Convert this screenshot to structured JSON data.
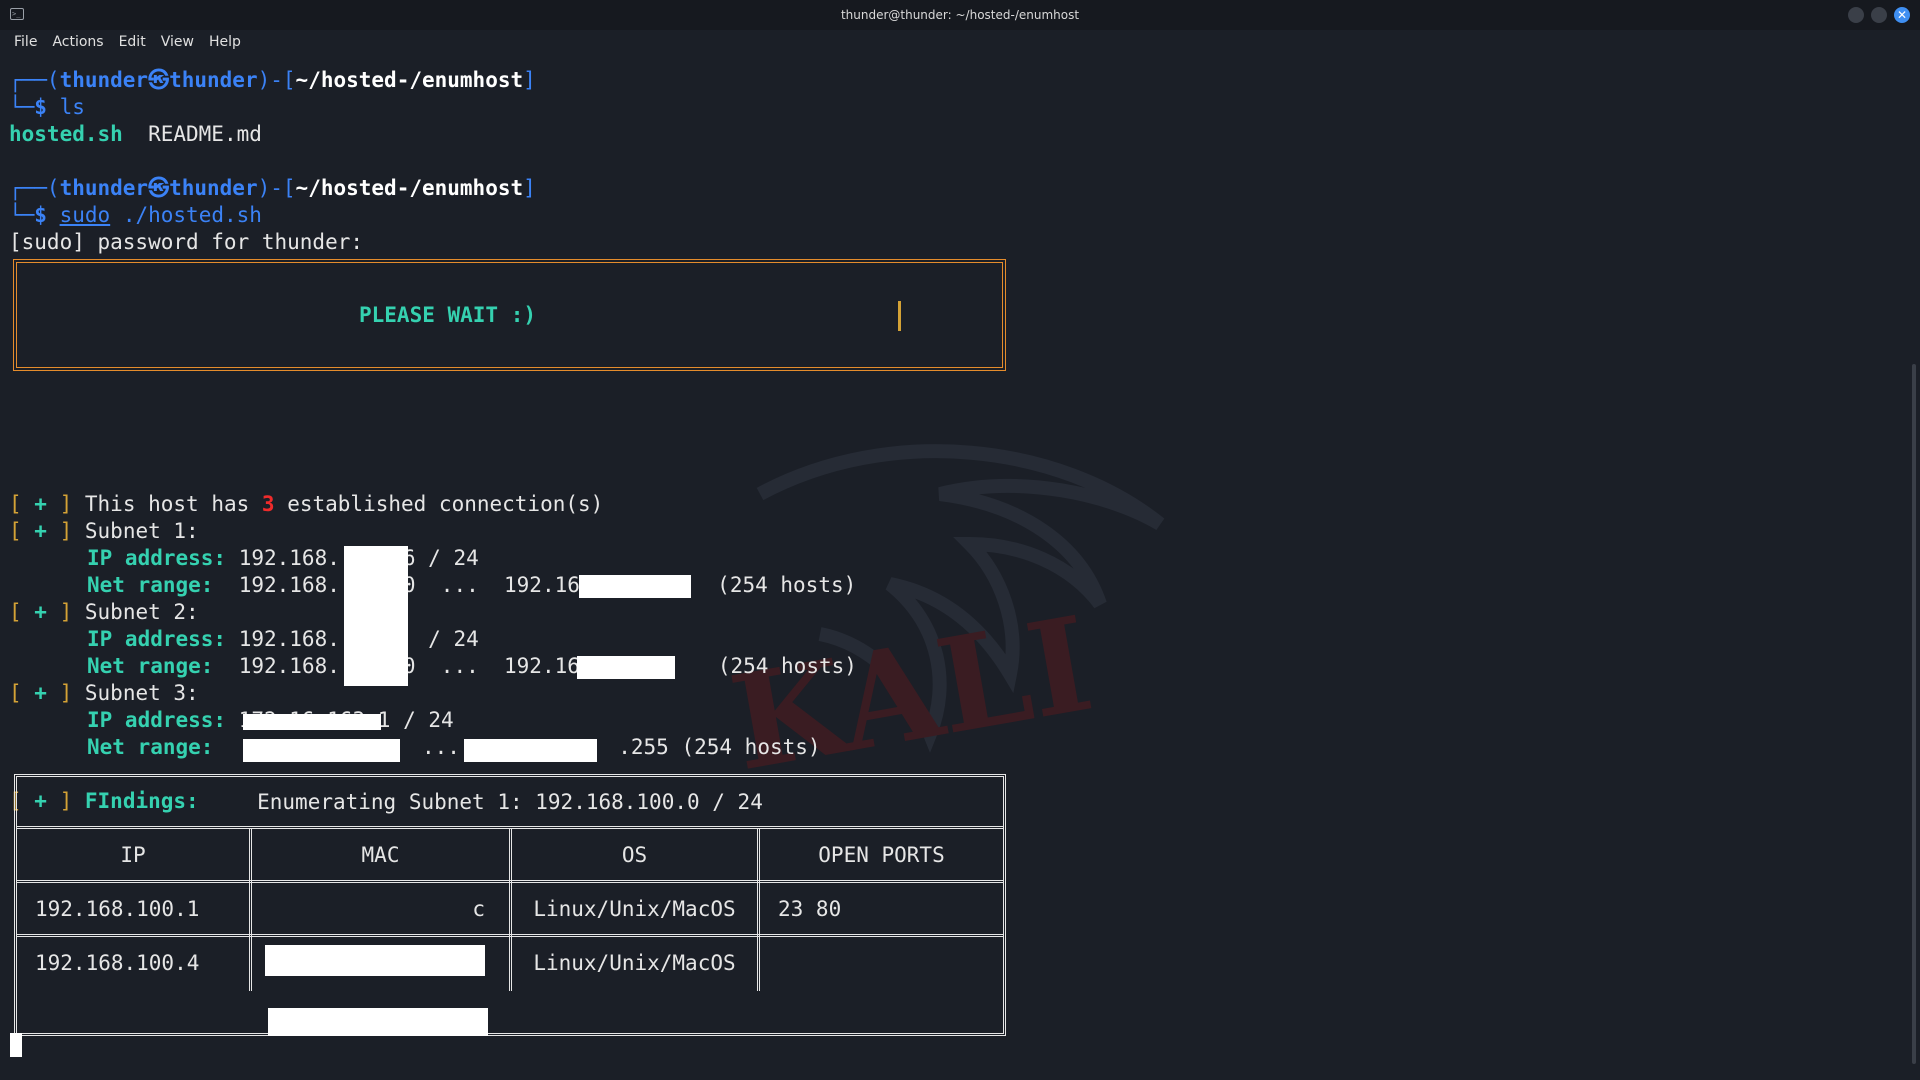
{
  "window": {
    "title": "thunder@thunder: ~/hosted-/enumhost",
    "icons": {
      "app": "terminal-icon",
      "minimize": "minimize-icon",
      "maximize": "maximize-icon",
      "close": "close-icon"
    },
    "close_glyph": "✕"
  },
  "menu": [
    "File",
    "Actions",
    "Edit",
    "View",
    "Help"
  ],
  "prompt": {
    "open": "┌──(",
    "user": "thunder",
    "at_symbol": "㉿",
    "host": "thunder",
    "mid": ")-[",
    "path": "~/hosted-/enumhost",
    "close": "]",
    "second_line": "└─",
    "dollar": "$"
  },
  "commands": [
    {
      "cmd": "ls"
    },
    {
      "cmd_sudo": "sudo",
      "cmd_rest": " ./hosted.sh"
    }
  ],
  "ls_output": {
    "file1": "hosted.sh",
    "file2": "  README.md"
  },
  "sudo_prompt": "[sudo] password for thunder:",
  "banner": "PLEASE WAIT :)",
  "bullet_open": "[",
  "bullet_plus": " + ",
  "bullet_close": "]",
  "connections": {
    "pre": " This host has ",
    "count": "3",
    "post": " established connection(s)"
  },
  "subnets": [
    {
      "label": " Subnet 1:",
      "ip_label": "IP address:",
      "ip_a": " 192.168.",
      "ip_b": "6 / 24",
      "range_label": "Net range:",
      "range_a": "  192.168.",
      "range_b": "0  ...  192.168.",
      "range_c": "(254 hosts)"
    },
    {
      "label": " Subnet 2:",
      "ip_label": "IP address:",
      "ip_a": " 192.168.",
      "ip_b": "  / 24",
      "range_label": "Net range:",
      "range_a": "  192.168.",
      "range_b": "0  ...  192.168.",
      "range_c": " (254 hosts)"
    },
    {
      "label": " Subnet 3:",
      "ip_label": "IP address:",
      "ip_a": " 172.16.163.",
      "ip_b": "1 / 24",
      "range_label": "Net range:",
      "range_a": "  ",
      "range_b": "  ...  ",
      "range_c": ".255 (254 hosts)"
    }
  ],
  "findings_label": " FIndings:",
  "table": {
    "title": "Enumerating Subnet 1: 192.168.100.0 / 24",
    "headers": [
      "IP",
      "MAC",
      "OS",
      "OPEN PORTS"
    ],
    "rows": [
      {
        "ip": "192.168.100.1",
        "mac_tail": "c",
        "os": "Linux/Unix/MacOS",
        "ports": "23 80"
      },
      {
        "ip": "192.168.100.4",
        "mac_tail": "",
        "os": "Linux/Unix/MacOS",
        "ports": ""
      }
    ]
  },
  "colors": {
    "background": "#1b1f27",
    "prompt_blue": "#3b82f6",
    "accent_green": "#35d1b0",
    "banner_border": "#e58c2c",
    "bracket_gold": "#d4a236",
    "count_red": "#ef2b2b"
  }
}
